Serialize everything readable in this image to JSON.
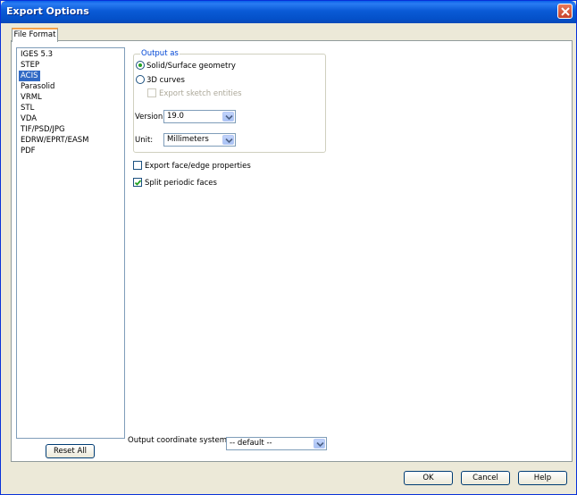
{
  "window": {
    "title": "Export Options"
  },
  "tabs": [
    {
      "label": "File Format"
    }
  ],
  "formats": [
    {
      "label": "IGES 5.3",
      "selected": false
    },
    {
      "label": "STEP",
      "selected": false
    },
    {
      "label": "ACIS",
      "selected": true
    },
    {
      "label": "Parasolid",
      "selected": false
    },
    {
      "label": "VRML",
      "selected": false
    },
    {
      "label": "STL",
      "selected": false
    },
    {
      "label": "VDA",
      "selected": false
    },
    {
      "label": "TIF/PSD/JPG",
      "selected": false
    },
    {
      "label": "EDRW/EPRT/EASM",
      "selected": false
    },
    {
      "label": "PDF",
      "selected": false
    }
  ],
  "reset_all_label": "Reset All",
  "output_as": {
    "group_label": "Output as",
    "solid_surface_label": "Solid/Surface geometry",
    "solid_surface_checked": true,
    "curves_label": "3D curves",
    "curves_checked": false,
    "export_sketch_label": "Export sketch entities",
    "export_sketch_checked": false,
    "version_label": "Version:",
    "version_value": "19.0",
    "unit_label": "Unit:",
    "unit_value": "Millimeters"
  },
  "export_face_edge_label": "Export face/edge properties",
  "export_face_edge_checked": false,
  "split_periodic_label": "Split periodic faces",
  "split_periodic_checked": true,
  "coord_system_label": "Output coordinate system:",
  "coord_system_value": "-- default --",
  "buttons": {
    "ok": "OK",
    "cancel": "Cancel",
    "help": "Help"
  },
  "colors": {
    "titlebar": "#0a5ad6",
    "selection": "#316ac5",
    "group_label": "#0046d5",
    "check": "#21a121"
  },
  "icons": {
    "close": "close-icon",
    "dropdown": "chevron-down-icon"
  }
}
